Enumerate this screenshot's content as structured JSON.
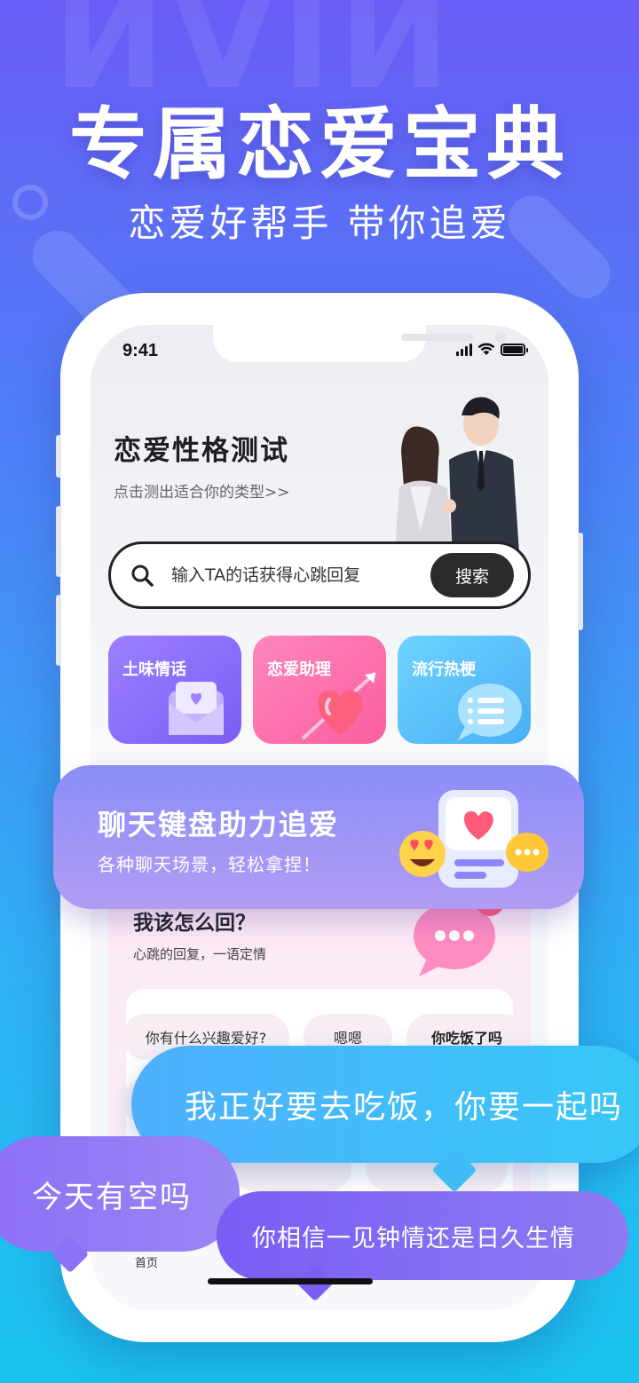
{
  "hero": {
    "title": "专属恋爱宝典",
    "subtitle": "恋爱好帮手 带你追爱"
  },
  "status_bar": {
    "time": "9:41",
    "icons": [
      "signal-icon",
      "wifi-icon",
      "battery-icon"
    ]
  },
  "personality_test": {
    "title": "恋爱性格测试",
    "subtitle": "点击测出适合你的类型>>"
  },
  "search": {
    "placeholder": "输入TA的话获得心跳回复",
    "button_label": "搜索"
  },
  "features": [
    {
      "label": "土味情话",
      "icon": "love-letter-icon",
      "color": "#8a6cf7"
    },
    {
      "label": "恋爱助理",
      "icon": "heart-arrow-icon",
      "color": "#fb6fa8"
    },
    {
      "label": "流行热梗",
      "icon": "chat-bubble-icon",
      "color": "#55b9f7"
    }
  ],
  "promo_card": {
    "title": "聊天键盘助力追爱",
    "subtitle": "各种聊天场景，轻松拿捏！"
  },
  "reply_section": {
    "title": "我该怎么回？",
    "subtitle": "心跳的回复，一语定情",
    "badge_count": "3",
    "chips": [
      "你有什么兴趣爱好?",
      "嗯嗯",
      "你吃饭了吗"
    ]
  },
  "tabbar": {
    "home_label": "首页"
  },
  "bubbles": {
    "b1": "我正好要去吃饭，你要一起吗",
    "b2": "今天有空吗",
    "b3": "你相信一见钟情还是日久生情"
  },
  "colors": {
    "background_top": "#6a5cf6",
    "background_bottom": "#19c3ee",
    "search_button": "#2b2b2e"
  }
}
